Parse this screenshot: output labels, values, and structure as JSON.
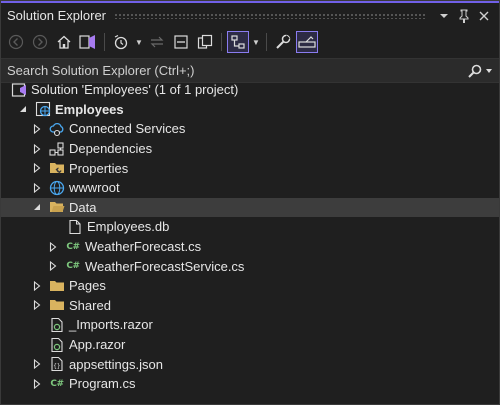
{
  "window": {
    "title": "Solution Explorer",
    "accent": "#7160e8"
  },
  "toolbar": {
    "buttons": [
      "back-icon",
      "forward-icon",
      "home-icon",
      "switch-views-icon",
      "pending-changes-icon",
      "sync-icon",
      "collapse-all-icon",
      "show-all-files-icon",
      "active-view-icon",
      "properties-icon",
      "preview-icon"
    ]
  },
  "search": {
    "placeholder": "Search Solution Explorer (Ctrl+;)"
  },
  "tree": {
    "solution": "Solution 'Employees' (1 of 1 project)",
    "project": "Employees",
    "items": {
      "connected_services": "Connected Services",
      "dependencies": "Dependencies",
      "properties": "Properties",
      "wwwroot": "wwwroot",
      "data": "Data",
      "employees_db": "Employees.db",
      "weather_forecast": "WeatherForecast.cs",
      "weather_forecast_service": "WeatherForecastService.cs",
      "pages": "Pages",
      "shared": "Shared",
      "imports": "_Imports.razor",
      "app": "App.razor",
      "appsettings": "appsettings.json",
      "program": "Program.cs"
    },
    "cs_badge": "C#"
  }
}
